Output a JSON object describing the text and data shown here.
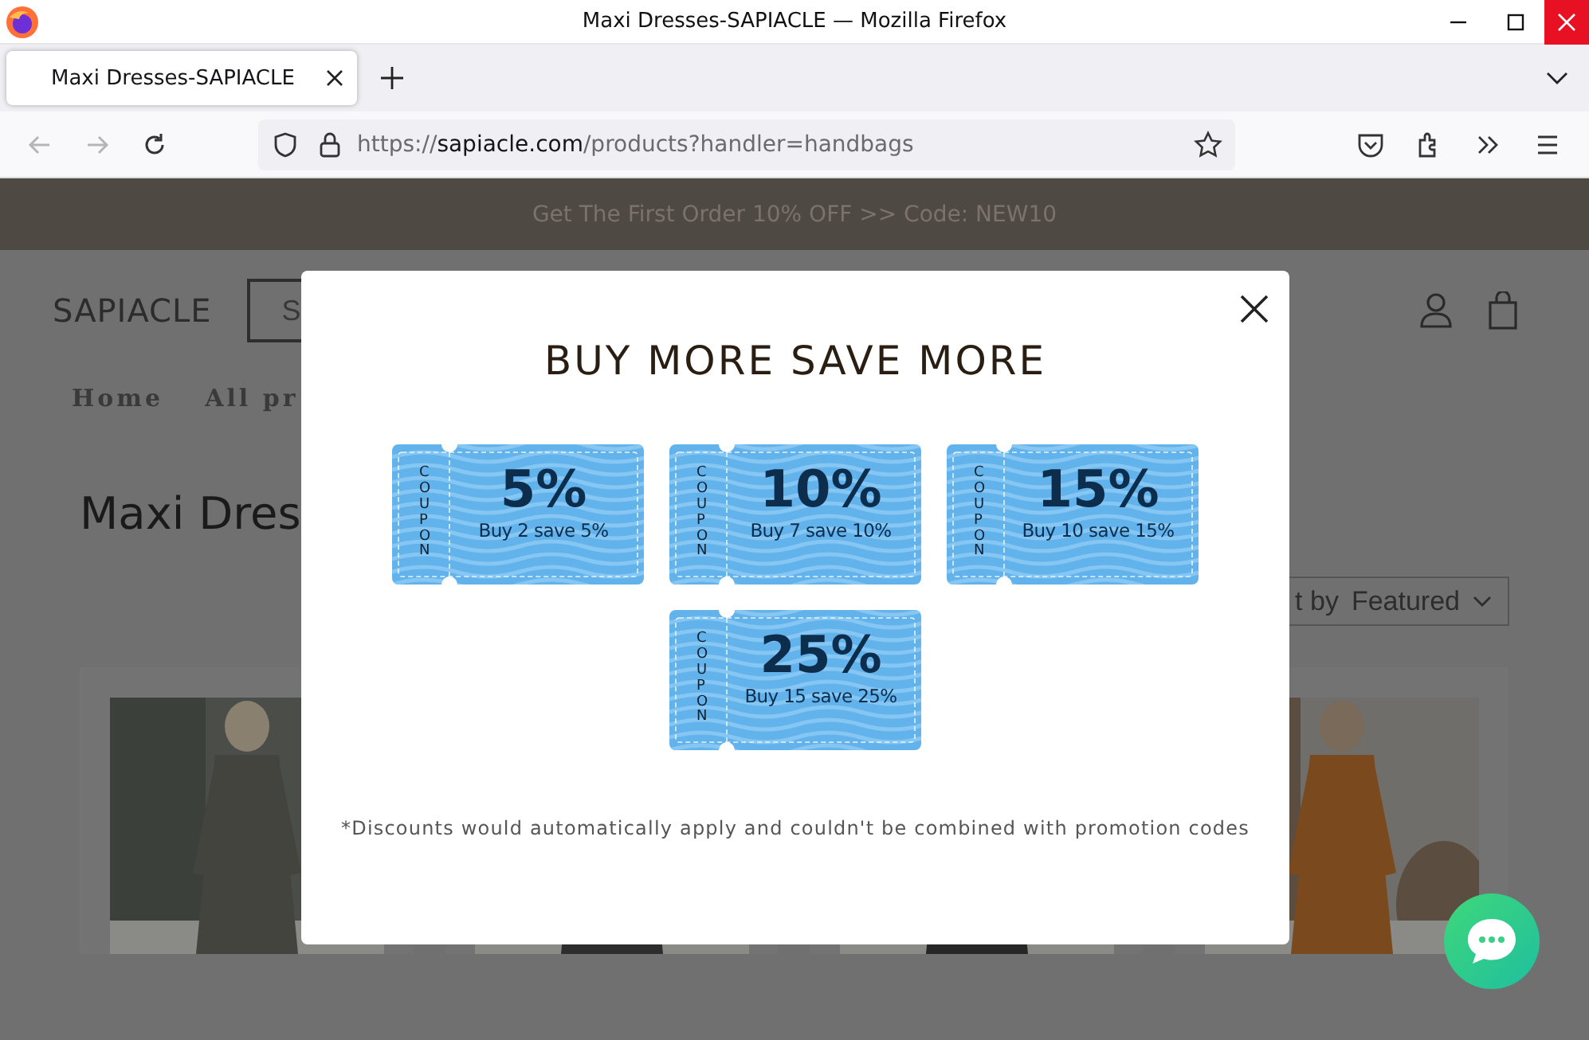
{
  "window": {
    "title": "Maxi Dresses-SAPIACLE — Mozilla Firefox"
  },
  "tabs": [
    {
      "label": "Maxi Dresses-SAPIACLE",
      "selected": true
    }
  ],
  "address_bar": {
    "scheme": "https://",
    "domain": "sapiacle.com",
    "path": "/products?handler=handbags"
  },
  "page": {
    "announcement": "Get The First Order 10% OFF >> Code: NEW10",
    "logo": "SAPIACLE",
    "search_button": "S",
    "nav": [
      "Home",
      "All pr"
    ],
    "heading": "Maxi Dres",
    "sort": {
      "label": "t by",
      "value": "Featured"
    }
  },
  "popup": {
    "title": "BUY MORE SAVE MORE",
    "coupons": [
      {
        "stub": "COUPON",
        "percent": "5%",
        "text": "Buy 2 save 5%"
      },
      {
        "stub": "COUPON",
        "percent": "10%",
        "text": "Buy 7 save 10%"
      },
      {
        "stub": "COUPON",
        "percent": "15%",
        "text": "Buy 10 save 15%"
      },
      {
        "stub": "COUPON",
        "percent": "25%",
        "text": "Buy 15 save 25%"
      }
    ],
    "note": "*Discounts would automatically apply and couldn't be combined with promotion codes"
  }
}
